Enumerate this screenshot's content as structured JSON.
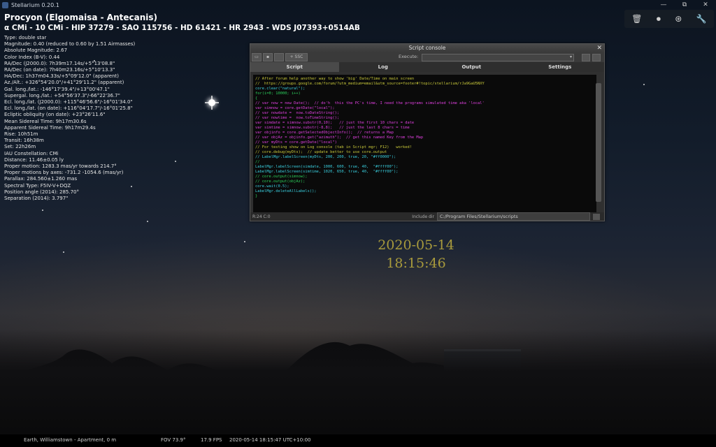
{
  "window": {
    "title": "Stellarium 0.20.1",
    "minimize": "—",
    "maximize": "⧉",
    "close": "✕"
  },
  "object": {
    "name": "Procyon (Elgomaisa - Antecanis)",
    "ids": "α CMi - 10 CMi - HIP 37279 - SAO 115756 - HD 61421 - HR 2943 - WDS J07393+0514AB",
    "lines": [
      "Type: double star",
      "Magnitude: 0.40 (reduced to 0.60 by 1.51 Airmasses)",
      "Absolute Magnitude: 2.67",
      "Color Index (B-V): 0.44",
      "RA/Dec (J2000.0): 7h39m17.14s/+5°13'08.8\"",
      "RA/Dec (on date): 7h40m23.16s/+5°10'13.3\"",
      "HA/Dec: 1h37m04.33s/+5°09'12.0\" (apparent)",
      "Az./Alt.: +326°54'20.0\"/+41°29'11.2\" (apparent)",
      "Gal. long./lat.: -146°17'39.4\"/+13°00'47.1\"",
      "Supergal. long./lat.: +54°56'37.3\"/-66°22'36.7\"",
      "Ecl. long./lat. (J2000.0): +115°46'56.6\"/-16°01'34.0\"",
      "Ecl. long./lat. (on date): +116°04'17.7\"/-16°01'25.8\"",
      "Ecliptic obliquity (on date): +23°26'11.6\"",
      "Mean Sidereal Time: 9h17m30.6s",
      "Apparent Sidereal Time: 9h17m29.4s",
      "Rise: 10h51m",
      "Transit: 16h38m",
      "Set: 22h26m",
      "IAU Constellation: CMi",
      "Distance: 11.46±0.05 ly",
      "Proper motion: 1283.3 mas/yr towards 214.7°",
      "Proper motions by axes: -731.2 -1054.6 (mas/yr)",
      "Parallax: 284.560±1.260 mas",
      "Spectral Type: F5IV-V+DQZ",
      "Position angle (2014): 285.70°",
      "Separation (2014): 3.797\""
    ]
  },
  "console": {
    "title": "Script console",
    "close": "✕",
    "ssc_label": "+ SSC",
    "execute_label": "Execute:",
    "tabs": [
      "Script",
      "Log",
      "Output",
      "Settings"
    ],
    "code": [
      {
        "c": "cm",
        "t": "// After forum help another way to show 'big' Date/Time on main screen"
      },
      {
        "c": "cm",
        "t": "//  https://groups.google.com/forum/?utm_medium=email&utm_source=footer#!topic/stellarium/rJa9GaU5NXY"
      },
      {
        "c": "fn",
        "t": "core.clear(\"natural\");"
      },
      {
        "c": "tx",
        "t": "for(i=0; 10000; i++)"
      },
      {
        "c": "tx",
        "t": "{"
      },
      {
        "c": "kw",
        "t": "// var now = new Date();  // do'h  this the PC's time, I need the programs simulated time aka 'local'"
      },
      {
        "c": "kw",
        "t": "var simnow = core.getDate(\"local\");"
      },
      {
        "c": "kw",
        "t": "// var nowdate =  now.toDateString();"
      },
      {
        "c": "kw",
        "t": "// var nowtime =  now.toTimeString();"
      },
      {
        "c": "kw",
        "t": "var simdate = simnow.substr(0,10);   // just the first 10 chars = date"
      },
      {
        "c": "kw",
        "t": "var simtime = simnow.substr(-8,8);   // just the last 8 chars = time"
      },
      {
        "c": "kw",
        "t": "var objinfo = core.getSelectedObjectInfo();  // returns a Map"
      },
      {
        "c": "kw",
        "t": "// var objAz = objinfo.get(\"azimuth\");  // get this named Key from the Map"
      },
      {
        "c": "kw",
        "t": "// var myDts = core.getDate(\"local\")"
      },
      {
        "c": "cm",
        "t": "// For testing show on Log console (tab in Script mgr; F12)   worked!"
      },
      {
        "c": "cm",
        "t": "// core.debug(myDts);  // update better to use core.output"
      },
      {
        "c": "fn",
        "t": "// LabelMgr.labelScreen(myDts, 200, 200, true, 20, \"#ff0000\");"
      },
      {
        "c": "tx",
        "t": "//"
      },
      {
        "c": "fn",
        "t": "LabelMgr.labelScreen(simdate, 1000, 600, true, 40,  \"#ffff00\");"
      },
      {
        "c": "fn",
        "t": "LabelMgr.labelScreen(simtime, 1020, 650, true, 40,  \"#ffff00\");"
      },
      {
        "c": "tx",
        "t": "// core.output(simnow);"
      },
      {
        "c": "tx",
        "t": "// core.output(objAz);"
      },
      {
        "c": "fn",
        "t": "core.wait(0.5);"
      },
      {
        "c": "fn",
        "t": "LabelMgr.deleteAllLabels();"
      },
      {
        "c": "tx",
        "t": "}"
      }
    ],
    "status_pos": "R:24 C:0",
    "include_label": "Include dir",
    "include_path": "C:/Program Files/Stellarium/scripts"
  },
  "overlay": {
    "date": "2020-05-14",
    "time": "18:15:46"
  },
  "statusbar": {
    "location": "Earth, Williamstown - Apartment, 0 m",
    "fov": "FOV 73.9°",
    "fps": "17.9 FPS",
    "datetime": "2020-05-14 18:15:47 UTC+10:00"
  },
  "toolbar_icons": [
    "trash-icon",
    "stop-icon",
    "globe-icon",
    "wrench-icon"
  ],
  "colors": {
    "accent": "#a89a3c",
    "console_bg": "#303030",
    "code_bg": "#0a0a0a"
  }
}
